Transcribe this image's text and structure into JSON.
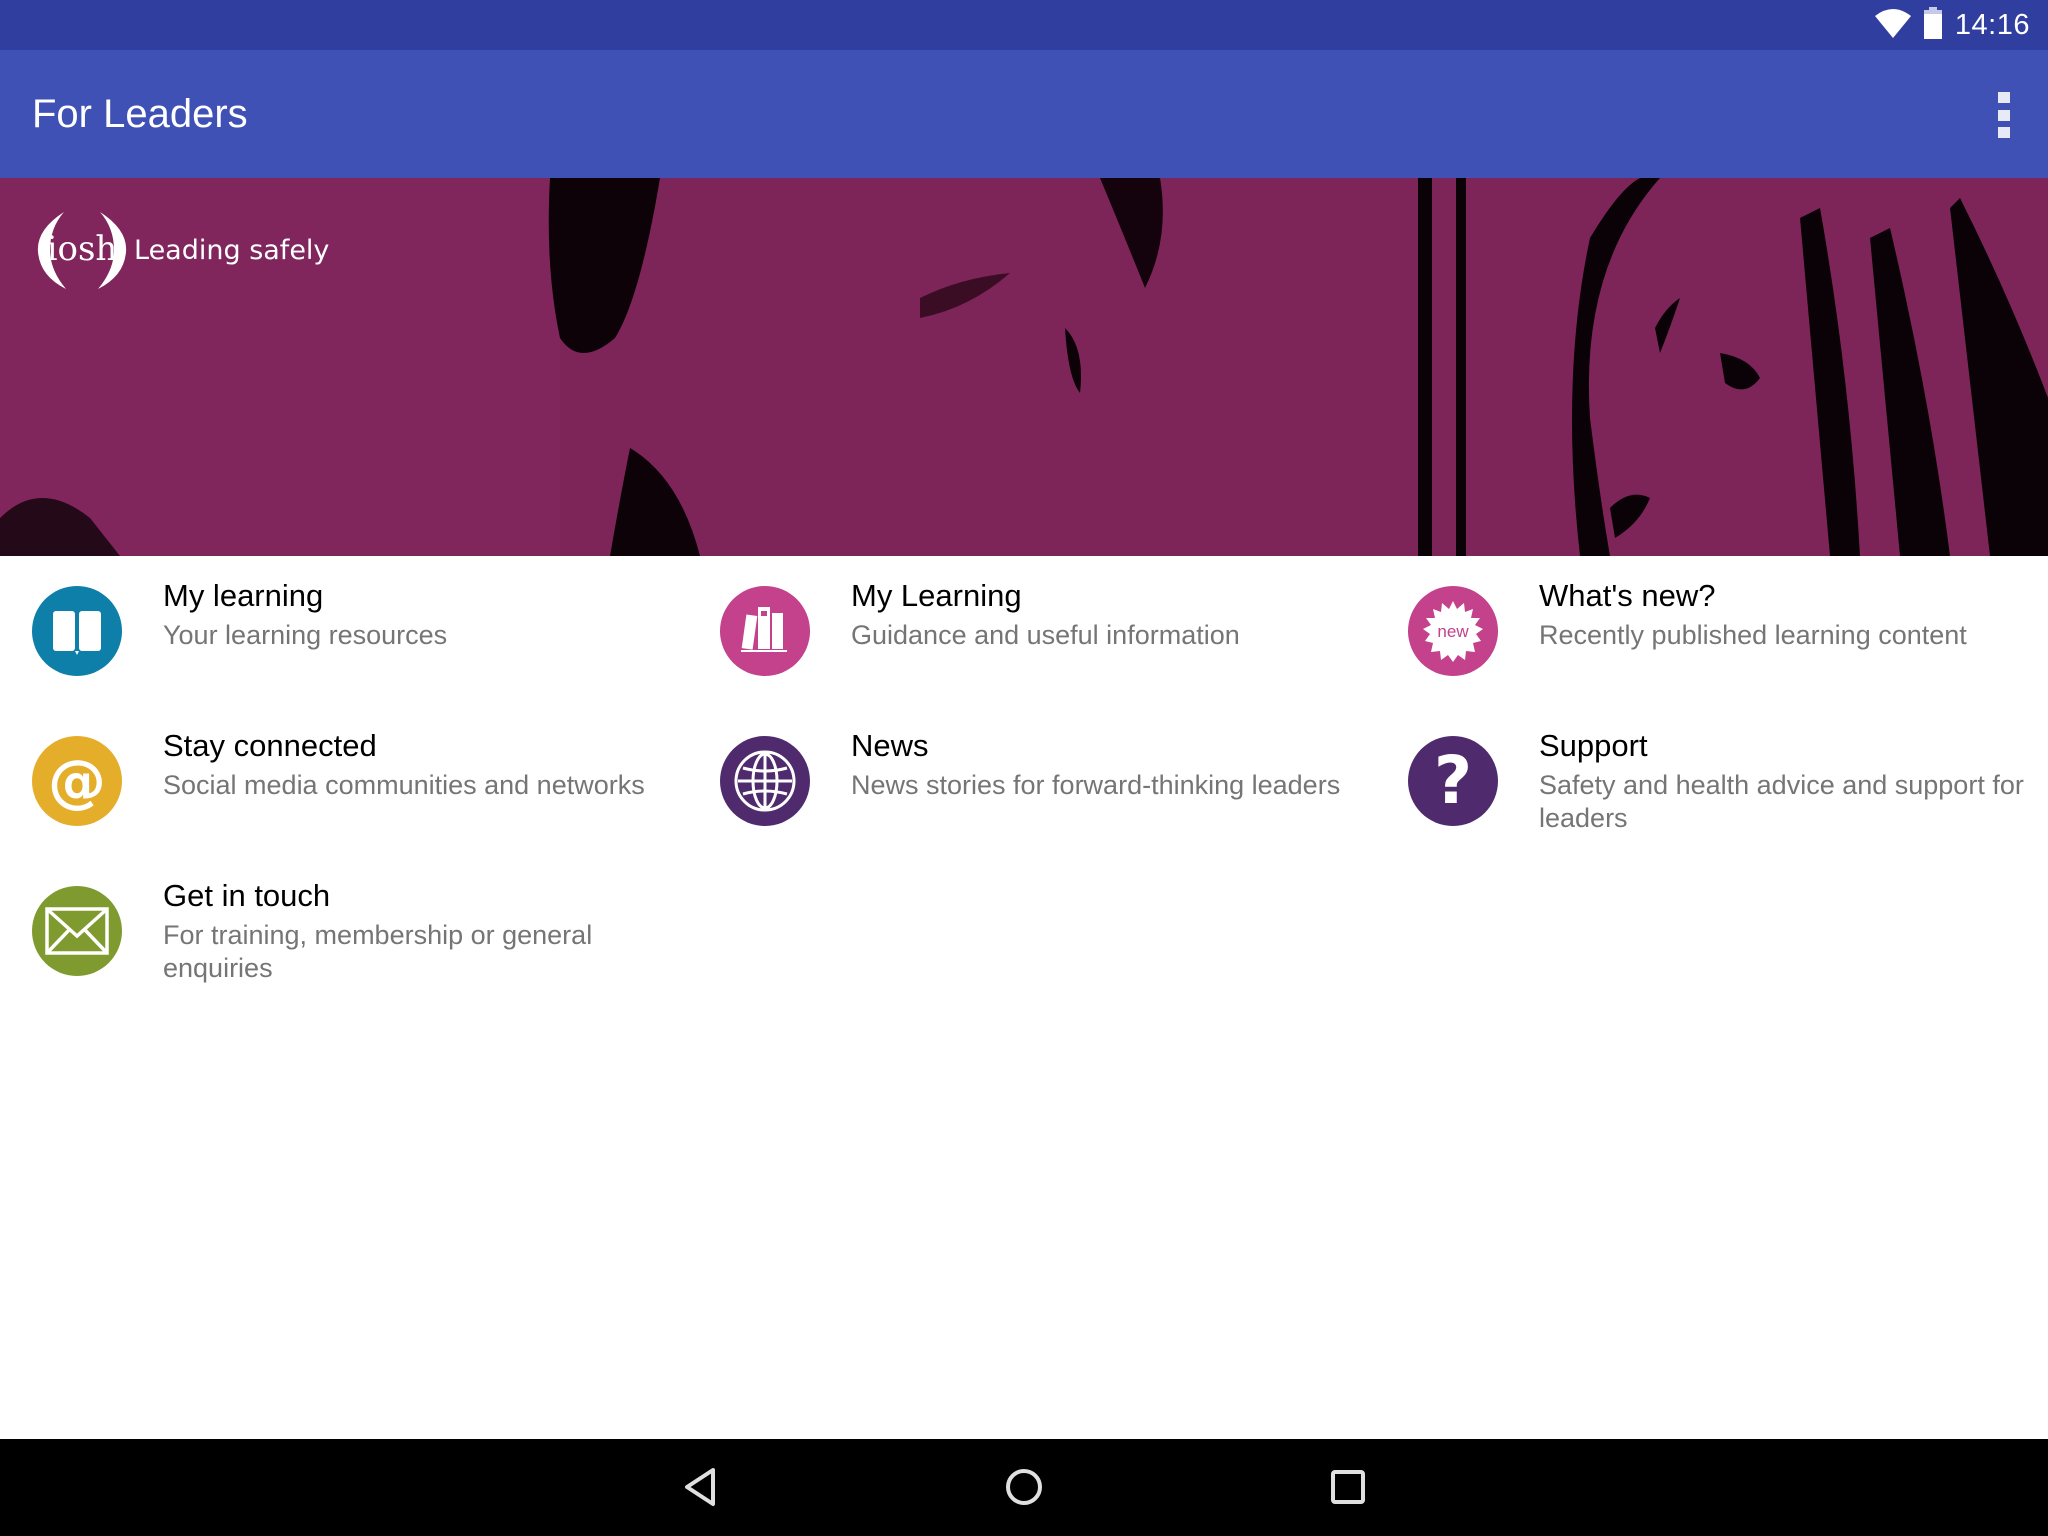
{
  "status_bar": {
    "time": "14:16",
    "icons": [
      "wifi-icon",
      "battery-icon"
    ],
    "color": "#303F9F"
  },
  "app_bar": {
    "title": "For Leaders",
    "menu_icon": "overflow-menu-icon",
    "color": "#3F51B5"
  },
  "hero": {
    "logo_mark": "iosh",
    "tagline": "Leading safely",
    "tint_color": "#7D2558"
  },
  "menu": {
    "items": [
      {
        "title": "My learning",
        "subtitle": "Your learning resources",
        "icon": "book-icon",
        "color": "#0D7FA8"
      },
      {
        "title": "My Learning",
        "subtitle": "Guidance and useful information",
        "icon": "books-icon",
        "color": "#C4418B"
      },
      {
        "title": "What's new?",
        "subtitle": "Recently published learning content",
        "icon": "new-badge-icon",
        "icon_text": "new",
        "color": "#C4418B"
      },
      {
        "title": "Stay connected",
        "subtitle": "Social media communities and networks",
        "icon": "at-sign-icon",
        "icon_text": "@",
        "color": "#E5AE2A"
      },
      {
        "title": "News",
        "subtitle": "News stories for forward-thinking leaders",
        "icon": "globe-icon",
        "color": "#4F2B6E"
      },
      {
        "title": "Support",
        "subtitle": "Safety and health advice and support for leaders",
        "icon": "question-icon",
        "icon_text": "?",
        "color": "#4F2B6E"
      },
      {
        "title": "Get in touch",
        "subtitle": "For training, membership or general enquiries",
        "icon": "envelope-icon",
        "color": "#7F9A2E"
      }
    ]
  },
  "nav_bar": {
    "buttons": [
      "back",
      "home",
      "recents"
    ]
  }
}
